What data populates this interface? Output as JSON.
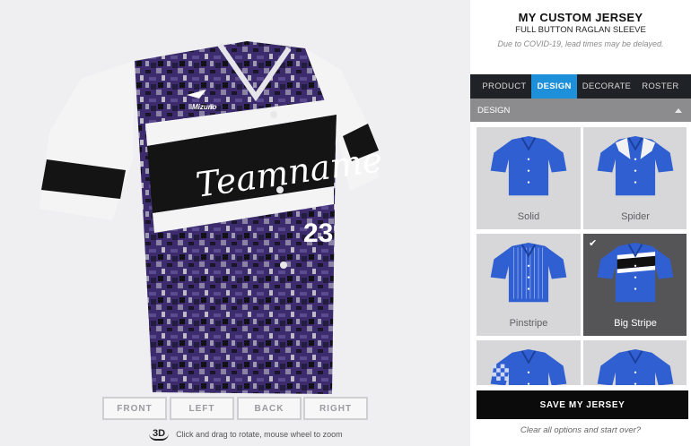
{
  "header": {
    "title": "MY CUSTOM JERSEY",
    "subtitle": "FULL BUTTON RAGLAN SLEEVE",
    "notice": "Due to COVID-19, lead times may be delayed."
  },
  "tabs": [
    {
      "label": "PRODUCT",
      "active": false
    },
    {
      "label": "DESIGN",
      "active": true
    },
    {
      "label": "DECORATE",
      "active": false
    },
    {
      "label": "ROSTER",
      "active": false
    }
  ],
  "section": {
    "label": "DESIGN"
  },
  "designs": [
    {
      "label": "Solid",
      "selected": false
    },
    {
      "label": "Spider",
      "selected": false
    },
    {
      "label": "Pinstripe",
      "selected": false
    },
    {
      "label": "Big Stripe",
      "selected": true
    },
    {
      "label": "",
      "selected": false
    },
    {
      "label": "",
      "selected": false
    }
  ],
  "save_label": "SAVE MY JERSEY",
  "clear_label": "Clear all options and start over?",
  "views": [
    "FRONT",
    "LEFT",
    "BACK",
    "RIGHT"
  ],
  "hint": {
    "icon_text": "3D",
    "text": "Click and drag to rotate, mouse wheel to zoom"
  },
  "jersey": {
    "team_name": "Teamname",
    "number": "23",
    "brand": "Mizuno"
  },
  "colors": {
    "accent": "#1e8fd9",
    "tile_jersey": "#2f5fd1",
    "camo_purple": "#3a2a6b"
  }
}
